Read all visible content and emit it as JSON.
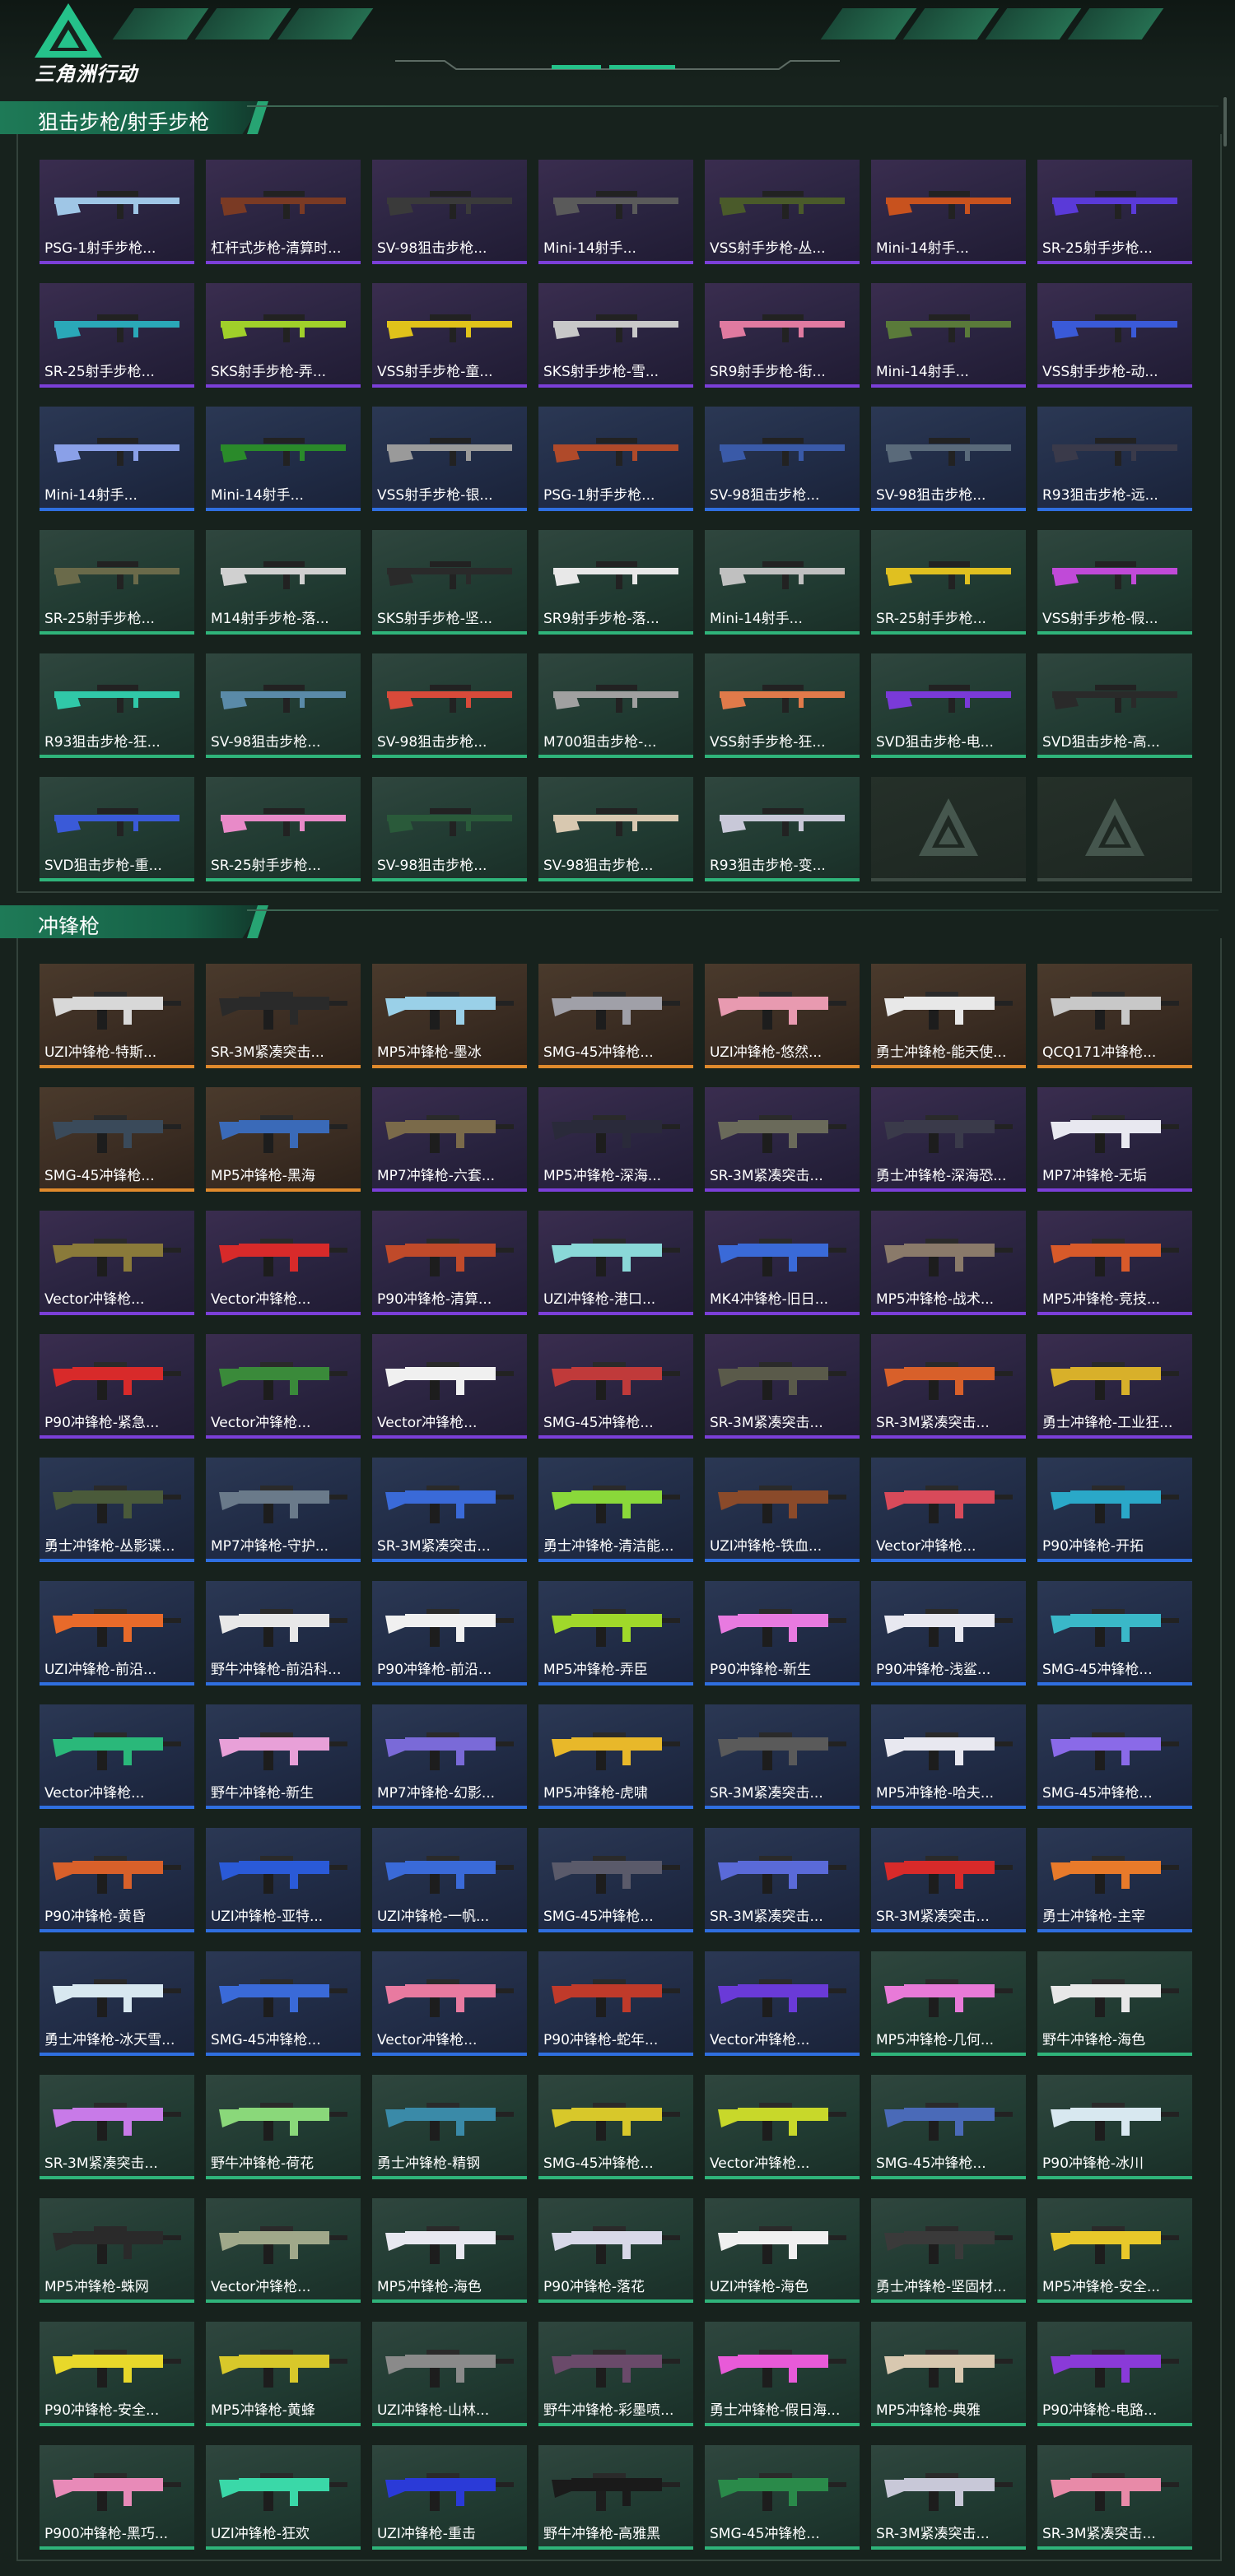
{
  "header": {
    "logo_text": "三角洲行动"
  },
  "sections": [
    {
      "title": "狙击步枪/射手步枪",
      "items": [
        {
          "label": "PSG-1射手步枪...",
          "rarity": "purple",
          "color": "#9fc6e6"
        },
        {
          "label": "杠杆式步枪-清算时...",
          "rarity": "purple",
          "color": "#7a3a24"
        },
        {
          "label": "SV-98狙击步枪...",
          "rarity": "purple",
          "color": "#3a3a3a"
        },
        {
          "label": "Mini-14射手...",
          "rarity": "purple",
          "color": "#5a5a5a"
        },
        {
          "label": "VSS射手步枪-丛...",
          "rarity": "purple",
          "color": "#4a5a2a"
        },
        {
          "label": "Mini-14射手...",
          "rarity": "purple",
          "color": "#c8521e"
        },
        {
          "label": "SR-25射手步枪...",
          "rarity": "purple",
          "color": "#5a3ad8"
        },
        {
          "label": "SR-25射手步枪...",
          "rarity": "purple",
          "color": "#2aa8b8"
        },
        {
          "label": "SKS射手步枪-弄...",
          "rarity": "purple",
          "color": "#a0d02a"
        },
        {
          "label": "VSS射手步枪-童...",
          "rarity": "purple",
          "color": "#e0c21a"
        },
        {
          "label": "SKS射手步枪-雪...",
          "rarity": "purple",
          "color": "#c8c8c8"
        },
        {
          "label": "SR9射手步枪-街...",
          "rarity": "purple",
          "color": "#e07aa0"
        },
        {
          "label": "Mini-14射手...",
          "rarity": "purple",
          "color": "#5a7a3a"
        },
        {
          "label": "VSS射手步枪-动...",
          "rarity": "purple",
          "color": "#3a5ad8"
        },
        {
          "label": "Mini-14射手...",
          "rarity": "blue",
          "color": "#8aa0e8"
        },
        {
          "label": "Mini-14射手...",
          "rarity": "blue",
          "color": "#2a8a2a"
        },
        {
          "label": "VSS射手步枪-银...",
          "rarity": "blue",
          "color": "#9a9a9a"
        },
        {
          "label": "PSG-1射手步枪...",
          "rarity": "blue",
          "color": "#b04a2a"
        },
        {
          "label": "SV-98狙击步枪...",
          "rarity": "blue",
          "color": "#3a5aa8"
        },
        {
          "label": "SV-98狙击步枪...",
          "rarity": "blue",
          "color": "#5a6a7a"
        },
        {
          "label": "R93狙击步枪-远...",
          "rarity": "blue",
          "color": "#3a3a4a"
        },
        {
          "label": "SR-25射手步枪...",
          "rarity": "green",
          "color": "#6a6a4a"
        },
        {
          "label": "M14射手步枪-落...",
          "rarity": "green",
          "color": "#d0d0d0"
        },
        {
          "label": "SKS射手步枪-坚...",
          "rarity": "green",
          "color": "#2a2a2a"
        },
        {
          "label": "SR9射手步枪-落...",
          "rarity": "green",
          "color": "#e8e8e8"
        },
        {
          "label": "Mini-14射手...",
          "rarity": "green",
          "color": "#c0c0c0"
        },
        {
          "label": "SR-25射手步枪...",
          "rarity": "green",
          "color": "#e0c020"
        },
        {
          "label": "VSS射手步枪-假...",
          "rarity": "green",
          "color": "#c04ad8"
        },
        {
          "label": "R93狙击步枪-狂...",
          "rarity": "green",
          "color": "#30c8a8"
        },
        {
          "label": "SV-98狙击步枪...",
          "rarity": "green",
          "color": "#5a8aa8"
        },
        {
          "label": "SV-98狙击步枪...",
          "rarity": "green",
          "color": "#d84a3a"
        },
        {
          "label": "M700狙击步枪-...",
          "rarity": "green",
          "color": "#a0a0a0"
        },
        {
          "label": "VSS射手步枪-狂...",
          "rarity": "green",
          "color": "#e07a4a"
        },
        {
          "label": "SVD狙击步枪-电...",
          "rarity": "green",
          "color": "#7a3ad8"
        },
        {
          "label": "SVD狙击步枪-高...",
          "rarity": "green",
          "color": "#2a2a2a"
        },
        {
          "label": "SVD狙击步枪-重...",
          "rarity": "green",
          "color": "#3a5ad8"
        },
        {
          "label": "SR-25射手步枪...",
          "rarity": "green",
          "color": "#e88ac8"
        },
        {
          "label": "SV-98狙击步枪...",
          "rarity": "green",
          "color": "#2a5a3a"
        },
        {
          "label": "SV-98狙击步枪...",
          "rarity": "green",
          "color": "#d8c8b0"
        },
        {
          "label": "R93狙击步枪-变...",
          "rarity": "green",
          "color": "#c8c8d8"
        },
        {
          "label": "",
          "rarity": "empty",
          "color": ""
        },
        {
          "label": "",
          "rarity": "empty",
          "color": ""
        }
      ]
    },
    {
      "title": "冲锋枪",
      "items": [
        {
          "label": "UZI冲锋枪-特斯...",
          "rarity": "orange",
          "color": "#d8d8d8"
        },
        {
          "label": "SR-3M紧凑突击...",
          "rarity": "orange",
          "color": "#2a2a2a"
        },
        {
          "label": "MP5冲锋枪-墨冰",
          "rarity": "orange",
          "color": "#9ad0e8"
        },
        {
          "label": "SMG-45冲锋枪...",
          "rarity": "orange",
          "color": "#a0a0a8"
        },
        {
          "label": "UZI冲锋枪-悠然...",
          "rarity": "orange",
          "color": "#e89ab0"
        },
        {
          "label": "勇士冲锋枪-能天使...",
          "rarity": "orange",
          "color": "#e8e8e8"
        },
        {
          "label": "QCQ171冲锋枪...",
          "rarity": "orange",
          "color": "#c8c8c8"
        },
        {
          "label": "SMG-45冲锋枪...",
          "rarity": "orange",
          "color": "#3a4a5a"
        },
        {
          "label": "MP5冲锋枪-黑海",
          "rarity": "orange",
          "color": "#3a6ab8"
        },
        {
          "label": "MP7冲锋枪-六套...",
          "rarity": "purple",
          "color": "#7a6a4a"
        },
        {
          "label": "MP5冲锋枪-深海...",
          "rarity": "purple",
          "color": "#2a2a3a"
        },
        {
          "label": "SR-3M紧凑突击...",
          "rarity": "purple",
          "color": "#6a6a5a"
        },
        {
          "label": "勇士冲锋枪-深海恐...",
          "rarity": "purple",
          "color": "#3a3a4a"
        },
        {
          "label": "MP7冲锋枪-无垢",
          "rarity": "purple",
          "color": "#e8e8f0"
        },
        {
          "label": "Vector冲锋枪...",
          "rarity": "purple",
          "color": "#8a7a3a"
        },
        {
          "label": "Vector冲锋枪...",
          "rarity": "purple",
          "color": "#d82a2a"
        },
        {
          "label": "P90冲锋枪-清算...",
          "rarity": "purple",
          "color": "#c04a2a"
        },
        {
          "label": "UZI冲锋枪-港口...",
          "rarity": "purple",
          "color": "#8ad8d8"
        },
        {
          "label": "MK4冲锋枪-旧日...",
          "rarity": "purple",
          "color": "#3a6ad8"
        },
        {
          "label": "MP5冲锋枪-战术...",
          "rarity": "purple",
          "color": "#8a7a6a"
        },
        {
          "label": "MP5冲锋枪-竞技...",
          "rarity": "purple",
          "color": "#d85a2a"
        },
        {
          "label": "P90冲锋枪-紧急...",
          "rarity": "purple",
          "color": "#d82a2a"
        },
        {
          "label": "Vector冲锋枪...",
          "rarity": "purple",
          "color": "#3a8a3a"
        },
        {
          "label": "Vector冲锋枪...",
          "rarity": "purple",
          "color": "#f0f0f0"
        },
        {
          "label": "SMG-45冲锋枪...",
          "rarity": "purple",
          "color": "#c03a3a"
        },
        {
          "label": "SR-3M紧凑突击...",
          "rarity": "purple",
          "color": "#5a5a4a"
        },
        {
          "label": "SR-3M紧凑突击...",
          "rarity": "purple",
          "color": "#d8602a"
        },
        {
          "label": "勇士冲锋枪-工业狂...",
          "rarity": "purple",
          "color": "#d8b02a"
        },
        {
          "label": "勇士冲锋枪-丛影谍...",
          "rarity": "blue",
          "color": "#4a5a3a"
        },
        {
          "label": "MP7冲锋枪-守护...",
          "rarity": "blue",
          "color": "#6a7a8a"
        },
        {
          "label": "SR-3M紧凑突击...",
          "rarity": "blue",
          "color": "#3a6ad8"
        },
        {
          "label": "勇士冲锋枪-清洁能...",
          "rarity": "blue",
          "color": "#8ad83a"
        },
        {
          "label": "UZI冲锋枪-铁血...",
          "rarity": "blue",
          "color": "#8a4a2a"
        },
        {
          "label": "Vector冲锋枪...",
          "rarity": "blue",
          "color": "#d84a5a"
        },
        {
          "label": "P90冲锋枪-开拓",
          "rarity": "blue",
          "color": "#2aa8c8"
        },
        {
          "label": "UZI冲锋枪-前沿...",
          "rarity": "blue",
          "color": "#e86a2a"
        },
        {
          "label": "野牛冲锋枪-前沿科...",
          "rarity": "blue",
          "color": "#e8e8e8"
        },
        {
          "label": "P90冲锋枪-前沿...",
          "rarity": "blue",
          "color": "#f0f0f0"
        },
        {
          "label": "MP5冲锋枪-弄臣",
          "rarity": "blue",
          "color": "#a0d82a"
        },
        {
          "label": "P90冲锋枪-新生",
          "rarity": "blue",
          "color": "#e87ae0"
        },
        {
          "label": "P90冲锋枪-浅鲨...",
          "rarity": "blue",
          "color": "#e8e8f0"
        },
        {
          "label": "SMG-45冲锋枪...",
          "rarity": "blue",
          "color": "#3ab8c8"
        },
        {
          "label": "Vector冲锋枪...",
          "rarity": "blue",
          "color": "#2ab87a"
        },
        {
          "label": "野牛冲锋枪-新生",
          "rarity": "blue",
          "color": "#e8a0d8"
        },
        {
          "label": "MP7冲锋枪-幻影...",
          "rarity": "blue",
          "color": "#7a6ad8"
        },
        {
          "label": "MP5冲锋枪-虎啸",
          "rarity": "blue",
          "color": "#e8b82a"
        },
        {
          "label": "SR-3M紧凑突击...",
          "rarity": "blue",
          "color": "#5a5a5a"
        },
        {
          "label": "MP5冲锋枪-哈夫...",
          "rarity": "blue",
          "color": "#e8e8f0"
        },
        {
          "label": "SMG-45冲锋枪...",
          "rarity": "blue",
          "color": "#8a6ae8"
        },
        {
          "label": "P90冲锋枪-黄昏",
          "rarity": "blue",
          "color": "#d8602a"
        },
        {
          "label": "UZI冲锋枪-亚特...",
          "rarity": "blue",
          "color": "#2a5ad8"
        },
        {
          "label": "UZI冲锋枪-一帆...",
          "rarity": "blue",
          "color": "#3a6ad8"
        },
        {
          "label": "SMG-45冲锋枪...",
          "rarity": "blue",
          "color": "#5a5a6a"
        },
        {
          "label": "SR-3M紧凑突击...",
          "rarity": "blue",
          "color": "#5a6ad8"
        },
        {
          "label": "SR-3M紧凑突击...",
          "rarity": "blue",
          "color": "#d82a2a"
        },
        {
          "label": "勇士冲锋枪-主宰",
          "rarity": "blue",
          "color": "#e87a2a"
        },
        {
          "label": "勇士冲锋枪-冰天雪...",
          "rarity": "blue",
          "color": "#d8e8f0"
        },
        {
          "label": "SMG-45冲锋枪...",
          "rarity": "blue",
          "color": "#3a6ad8"
        },
        {
          "label": "Vector冲锋枪...",
          "rarity": "blue",
          "color": "#e87aa0"
        },
        {
          "label": "P90冲锋枪-蛇年...",
          "rarity": "blue",
          "color": "#c03a2a"
        },
        {
          "label": "Vector冲锋枪...",
          "rarity": "blue",
          "color": "#6a3ad8"
        },
        {
          "label": "MP5冲锋枪-几何...",
          "rarity": "green",
          "color": "#e87ad8"
        },
        {
          "label": "野牛冲锋枪-海色",
          "rarity": "green",
          "color": "#e8e8e8"
        },
        {
          "label": "SR-3M紧凑突击...",
          "rarity": "green",
          "color": "#c87ae8"
        },
        {
          "label": "野牛冲锋枪-荷花",
          "rarity": "green",
          "color": "#8ad87a"
        },
        {
          "label": "勇士冲锋枪-精钢",
          "rarity": "green",
          "color": "#3a8aa8"
        },
        {
          "label": "SMG-45冲锋枪...",
          "rarity": "green",
          "color": "#d8c82a"
        },
        {
          "label": "Vector冲锋枪...",
          "rarity": "green",
          "color": "#c8d82a"
        },
        {
          "label": "SMG-45冲锋枪...",
          "rarity": "green",
          "color": "#4a6ab8"
        },
        {
          "label": "P90冲锋枪-冰川",
          "rarity": "green",
          "color": "#d8e8f0"
        },
        {
          "label": "MP5冲锋枪-蛛网",
          "rarity": "green",
          "color": "#2a2a2a"
        },
        {
          "label": "Vector冲锋枪...",
          "rarity": "green",
          "color": "#a0a88a"
        },
        {
          "label": "MP5冲锋枪-海色",
          "rarity": "green",
          "color": "#e8e8f0"
        },
        {
          "label": "P90冲锋枪-落花",
          "rarity": "green",
          "color": "#d8d8e8"
        },
        {
          "label": "UZI冲锋枪-海色",
          "rarity": "green",
          "color": "#f0f0f0"
        },
        {
          "label": "勇士冲锋枪-坚固材...",
          "rarity": "green",
          "color": "#3a3a3a"
        },
        {
          "label": "MP5冲锋枪-安全...",
          "rarity": "green",
          "color": "#e8c82a"
        },
        {
          "label": "P90冲锋枪-安全...",
          "rarity": "green",
          "color": "#e8d82a"
        },
        {
          "label": "MP5冲锋枪-黄蜂",
          "rarity": "green",
          "color": "#d8c82a"
        },
        {
          "label": "UZI冲锋枪-山林...",
          "rarity": "green",
          "color": "#8a8a8a"
        },
        {
          "label": "野牛冲锋枪-彩墨喷...",
          "rarity": "green",
          "color": "#6a4a6a"
        },
        {
          "label": "勇士冲锋枪-假日海...",
          "rarity": "green",
          "color": "#e85ad8"
        },
        {
          "label": "MP5冲锋枪-典雅",
          "rarity": "green",
          "color": "#d8c8b0"
        },
        {
          "label": "P90冲锋枪-电路...",
          "rarity": "green",
          "color": "#8a3ad8"
        },
        {
          "label": "P900冲锋枪-黑巧...",
          "rarity": "green",
          "color": "#e88ab8"
        },
        {
          "label": "UZI冲锋枪-狂欢",
          "rarity": "green",
          "color": "#3ad8a8"
        },
        {
          "label": "UZI冲锋枪-重击",
          "rarity": "green",
          "color": "#2a3ad8"
        },
        {
          "label": "野牛冲锋枪-高雅黑",
          "rarity": "green",
          "color": "#1a1a1a"
        },
        {
          "label": "SMG-45冲锋枪...",
          "rarity": "green",
          "color": "#2a8a4a"
        },
        {
          "label": "SR-3M紧凑突击...",
          "rarity": "green",
          "color": "#c8c8d8"
        },
        {
          "label": "SR-3M紧凑突击...",
          "rarity": "green",
          "color": "#e88aa8"
        }
      ]
    }
  ],
  "colors": {
    "purple": "#7b3fd8",
    "blue": "#2f6fe0",
    "green": "#2fb47a",
    "orange": "#e08a2c",
    "empty": "#3d4a43"
  }
}
